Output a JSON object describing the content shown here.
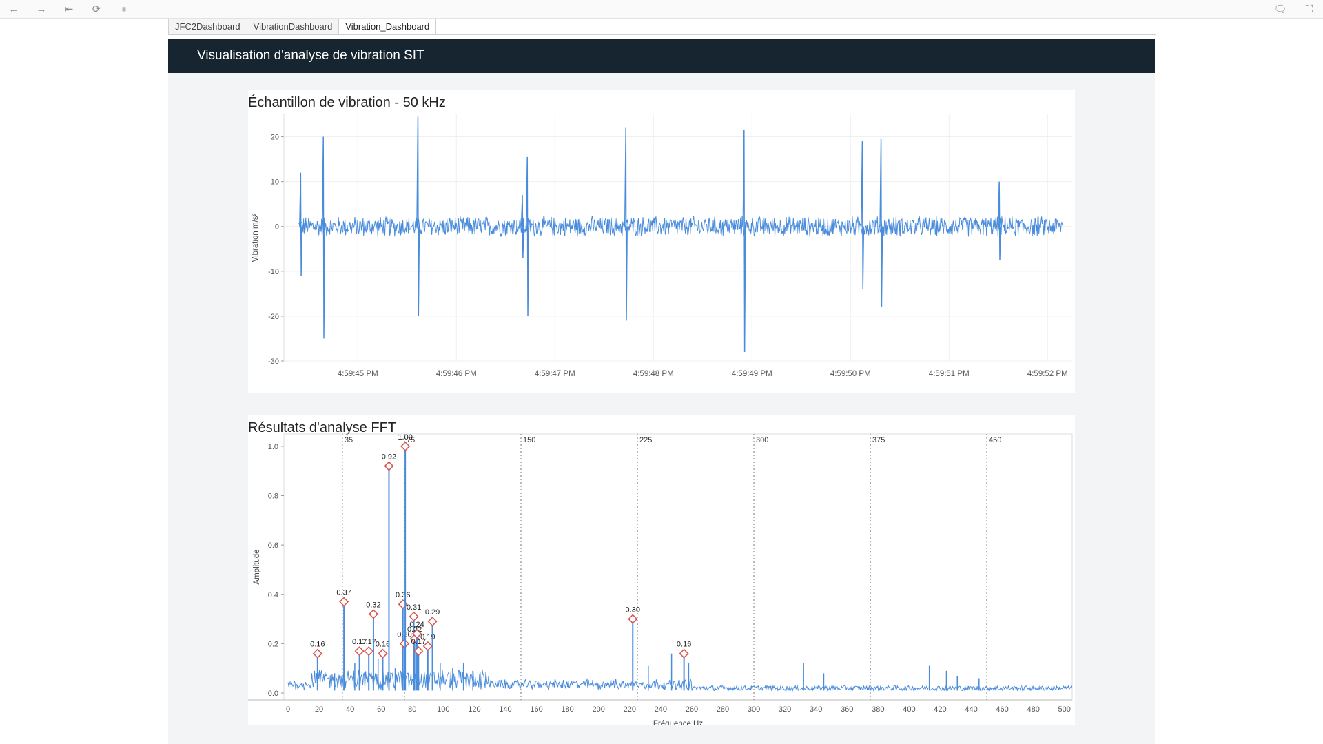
{
  "toolbar": {
    "buttons": [
      {
        "name": "back-icon",
        "glyph": "←"
      },
      {
        "name": "forward-icon",
        "glyph": "→"
      },
      {
        "name": "first-page-icon",
        "glyph": "⇤"
      },
      {
        "name": "refresh-icon",
        "glyph": "⟳"
      },
      {
        "name": "pause-icon",
        "glyph": "⏸"
      }
    ],
    "right_buttons": [
      {
        "name": "comment-icon",
        "glyph": "🗨"
      },
      {
        "name": "fullscreen-icon",
        "glyph": "⛶"
      }
    ]
  },
  "tabs": [
    "JFC2Dashboard",
    "VibrationDashboard",
    "Vibration_Dashboard"
  ],
  "active_tab": 2,
  "header": {
    "title": "Visualisation d'analyse de vibration SIT"
  },
  "colors": {
    "header_bg": "#16252f",
    "series": "#4a8cdc",
    "peak_marker": "#d9534f"
  },
  "chart_data": [
    {
      "type": "line",
      "title": "Échantillon de vibration - 50 kHz",
      "ylabel": "Vibration m/s²",
      "xlabel": "",
      "ylim": [
        -30,
        25
      ],
      "yticks": [
        20,
        10,
        0,
        -10,
        -20,
        -30
      ],
      "x_tick_labels": [
        "4:59:45 PM",
        "4:59:46 PM",
        "4:59:47 PM",
        "4:59:48 PM",
        "4:59:49 PM",
        "4:59:50 PM",
        "4:59:51 PM",
        "4:59:52 PM"
      ],
      "x_range_seconds": [
        44.25,
        52.25
      ],
      "signal_range_seconds": [
        44.4,
        52.15
      ],
      "noise_amplitude": 2.5,
      "spikes": [
        {
          "t": 44.42,
          "up": 12,
          "down": -11
        },
        {
          "t": 44.65,
          "up": 20,
          "down": -25
        },
        {
          "t": 45.61,
          "up": 24.5,
          "down": -20
        },
        {
          "t": 46.67,
          "up": 7,
          "down": -7
        },
        {
          "t": 46.72,
          "up": 15.5,
          "down": -20
        },
        {
          "t": 47.72,
          "up": 22,
          "down": -21
        },
        {
          "t": 48.92,
          "up": 21.5,
          "down": -28
        },
        {
          "t": 50.12,
          "up": 19,
          "down": -14
        },
        {
          "t": 50.31,
          "up": 19.5,
          "down": -18
        },
        {
          "t": 51.51,
          "up": 10,
          "down": -7.5
        }
      ],
      "grid": true,
      "series": [
        {
          "name": "",
          "color": "#4a8cdc"
        }
      ]
    },
    {
      "type": "line",
      "title": "Résultats d'analyse FFT",
      "xlabel": "Fréquence Hz",
      "ylabel": "Amplitude",
      "xlim": [
        0,
        505
      ],
      "ylim": [
        0,
        1.05
      ],
      "xticks": [
        0,
        20,
        40,
        60,
        80,
        100,
        120,
        140,
        160,
        180,
        200,
        220,
        240,
        260,
        280,
        300,
        320,
        340,
        360,
        380,
        400,
        420,
        440,
        460,
        480,
        500
      ],
      "yticks": [
        0.0,
        0.2,
        0.4,
        0.6,
        0.8,
        1.0
      ],
      "reference_lines": [
        {
          "x": 35,
          "label": "35"
        },
        {
          "x": 75,
          "label": "75"
        },
        {
          "x": 150,
          "label": "150"
        },
        {
          "x": 225,
          "label": "225"
        },
        {
          "x": 300,
          "label": "300"
        },
        {
          "x": 375,
          "label": "375"
        },
        {
          "x": 450,
          "label": "450"
        }
      ],
      "peaks": [
        {
          "f": 19,
          "a": 0.16,
          "label": "0.16"
        },
        {
          "f": 36,
          "a": 0.37,
          "label": "0.37"
        },
        {
          "f": 46,
          "a": 0.17,
          "label": "0.17"
        },
        {
          "f": 52,
          "a": 0.17,
          "label": "0.17"
        },
        {
          "f": 55,
          "a": 0.32,
          "label": "0.32"
        },
        {
          "f": 61,
          "a": 0.16,
          "label": "0.16"
        },
        {
          "f": 65,
          "a": 0.92,
          "label": "0.92"
        },
        {
          "f": 74,
          "a": 0.36,
          "label": "0.36"
        },
        {
          "f": 75,
          "a": 0.2,
          "label": "0.20"
        },
        {
          "f": 75.5,
          "a": 1.0,
          "label": "1.00"
        },
        {
          "f": 81,
          "a": 0.31,
          "label": "0.31"
        },
        {
          "f": 81.5,
          "a": 0.22,
          "label": "0.22"
        },
        {
          "f": 83,
          "a": 0.24,
          "label": "0.24"
        },
        {
          "f": 84,
          "a": 0.17,
          "label": "0.17"
        },
        {
          "f": 90,
          "a": 0.19,
          "label": "0.19"
        },
        {
          "f": 93,
          "a": 0.29,
          "label": "0.29"
        },
        {
          "f": 222,
          "a": 0.3,
          "label": "0.30"
        },
        {
          "f": 255,
          "a": 0.16,
          "label": "0.16"
        }
      ],
      "minor_peaks": [
        {
          "f": 30,
          "a": 0.08
        },
        {
          "f": 43,
          "a": 0.12
        },
        {
          "f": 58,
          "a": 0.14
        },
        {
          "f": 69,
          "a": 0.1
        },
        {
          "f": 98,
          "a": 0.12
        },
        {
          "f": 106,
          "a": 0.1
        },
        {
          "f": 113,
          "a": 0.12
        },
        {
          "f": 119,
          "a": 0.09
        },
        {
          "f": 232,
          "a": 0.11
        },
        {
          "f": 247,
          "a": 0.16
        },
        {
          "f": 258,
          "a": 0.12
        },
        {
          "f": 332,
          "a": 0.12
        },
        {
          "f": 345,
          "a": 0.08
        },
        {
          "f": 413,
          "a": 0.11
        },
        {
          "f": 424,
          "a": 0.09
        },
        {
          "f": 431,
          "a": 0.07
        },
        {
          "f": 445,
          "a": 0.06
        }
      ],
      "grid": true,
      "series": [
        {
          "name": "",
          "color": "#4a8cdc"
        }
      ]
    }
  ]
}
